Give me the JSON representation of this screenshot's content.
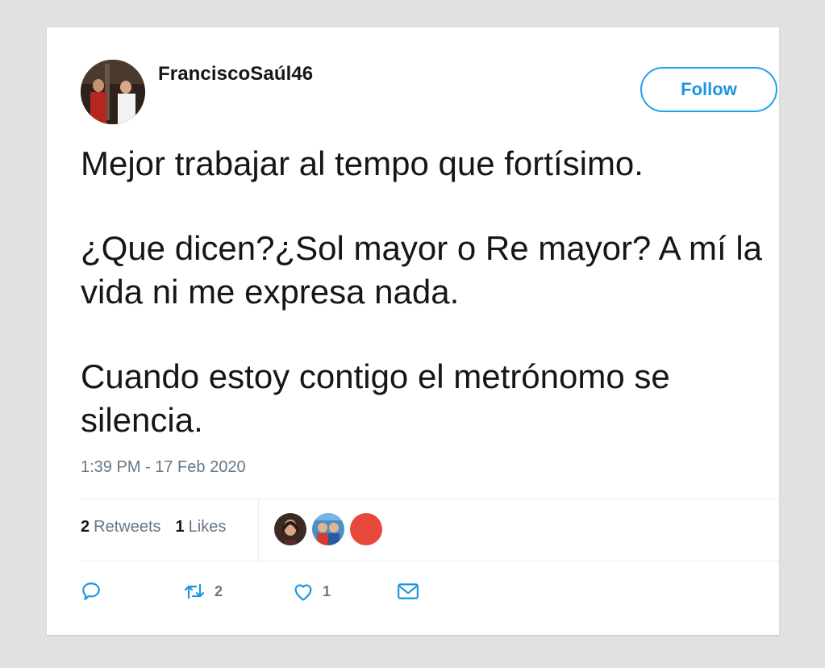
{
  "tweet": {
    "username": "FranciscoSaúl46",
    "follow_label": "Follow",
    "paragraphs": [
      "Mejor trabajar al tempo que fortísimo.",
      "¿Que dicen?¿Sol mayor o Re mayor? A mí la vida ni me expresa nada.",
      "Cuando estoy contigo el metrónomo se silencia."
    ],
    "timestamp": "1:39 PM - 17 Feb 2020",
    "stats": {
      "retweets_count": "2",
      "retweets_label": "Retweets",
      "likes_count": "1",
      "likes_label": "Likes"
    },
    "actions": {
      "retweet_count": "2",
      "like_count": "1"
    }
  },
  "colors": {
    "accent": "#1da1f2",
    "text": "#14171a",
    "muted": "#657786",
    "liker_red": "#e8483a"
  },
  "icons": [
    "reply-icon",
    "retweet-icon",
    "heart-icon",
    "envelope-icon"
  ]
}
